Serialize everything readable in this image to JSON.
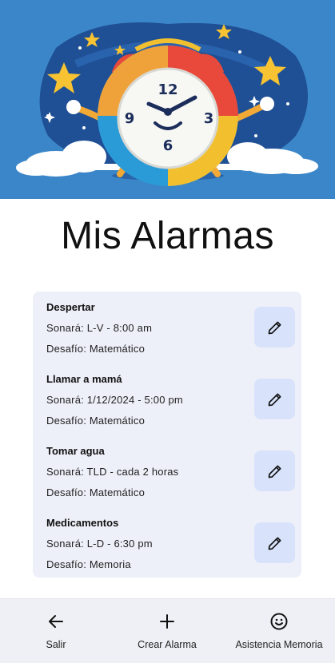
{
  "page": {
    "title": "Mis Alarmas"
  },
  "hero": {
    "clock_numbers": [
      "12",
      "3",
      "6",
      "9"
    ]
  },
  "alarms": [
    {
      "name": "Despertar",
      "schedule": "Sonará: L-V - 8:00 am",
      "challenge": "Desafío: Matemático"
    },
    {
      "name": "Llamar a mamá",
      "schedule": "Sonará: 1/12/2024 - 5:00 pm",
      "challenge": "Desafío: Matemático"
    },
    {
      "name": "Tomar agua",
      "schedule": "Sonará: TLD - cada 2 horas",
      "challenge": "Desafío: Matemático"
    },
    {
      "name": "Medicamentos",
      "schedule": "Sonará: L-D - 6:30 pm",
      "challenge": "Desafío: Memoria"
    }
  ],
  "icons": {
    "edit": "pencil-icon",
    "exit": "arrow-left-icon",
    "create": "plus-icon",
    "assist": "smiley-icon"
  },
  "nav": {
    "exit_label": "Salir",
    "create_label": "Crear Alarma",
    "assist_label": "Asistencia Memoria"
  },
  "colors": {
    "hero_background": "#2f6fbd",
    "list_background": "#eef0f9",
    "edit_button": "#d8e2fb",
    "nav_background": "#eef0f5"
  }
}
